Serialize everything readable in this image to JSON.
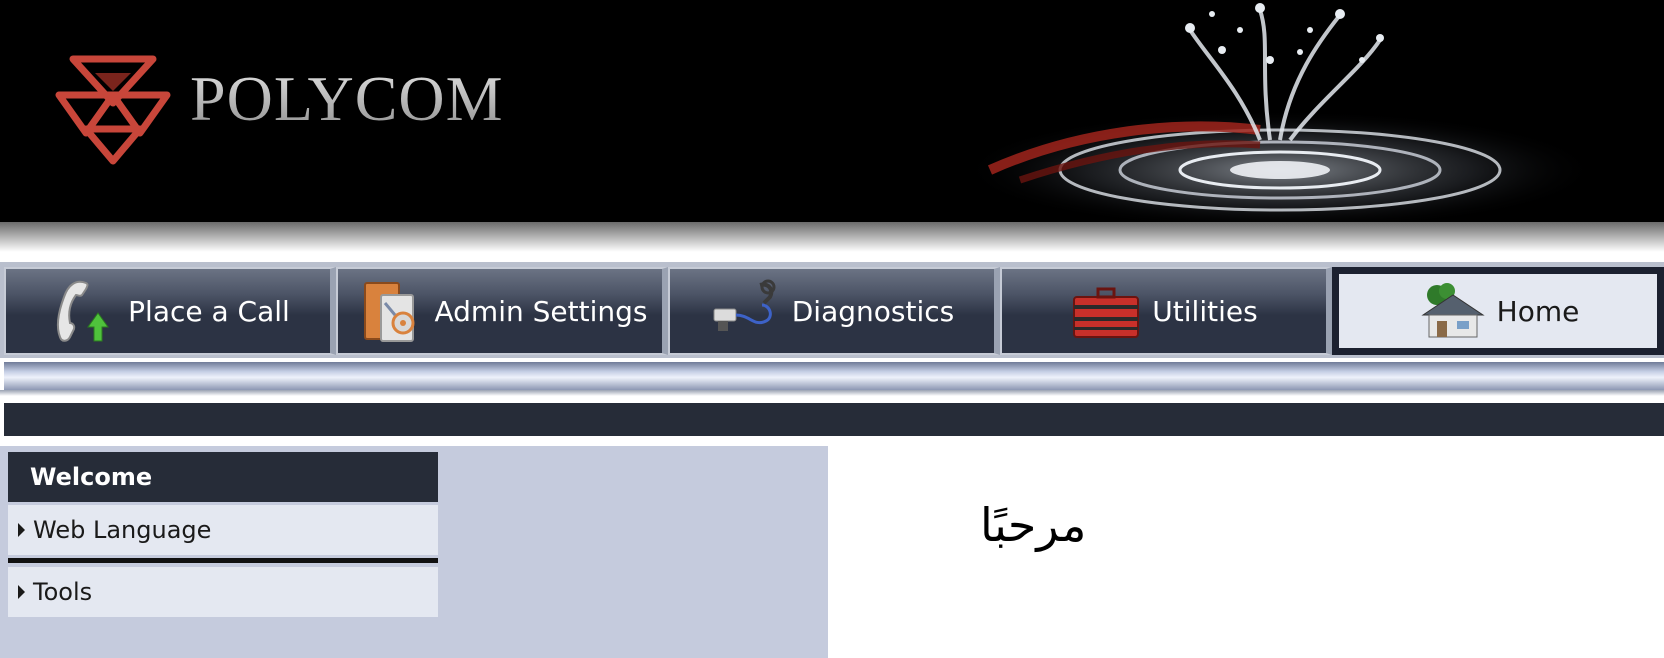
{
  "header": {
    "brand": "POLYCOM"
  },
  "nav": {
    "tabs": [
      {
        "label": "Place a Call",
        "icon": "phone-icon"
      },
      {
        "label": "Admin Settings",
        "icon": "admin-settings-icon"
      },
      {
        "label": "Diagnostics",
        "icon": "diagnostics-icon"
      },
      {
        "label": "Utilities",
        "icon": "toolbox-icon"
      },
      {
        "label": "Home",
        "icon": "house-icon",
        "active": true
      }
    ]
  },
  "sidebar": {
    "header": "Welcome",
    "items": [
      {
        "label": "Web Language",
        "icon": "triangle-right-icon"
      },
      {
        "label": "Tools",
        "icon": "triangle-right-icon"
      }
    ]
  },
  "main": {
    "welcome_text": "مرحبًا"
  },
  "colors": {
    "banner_bg": "#000000",
    "tab_dark": "#2c3344",
    "tab_active": "#e4e8f1",
    "sidebar_bg": "#c5cbdd",
    "menu_header_bg": "#262c38",
    "logo_red": "#c8463a"
  }
}
